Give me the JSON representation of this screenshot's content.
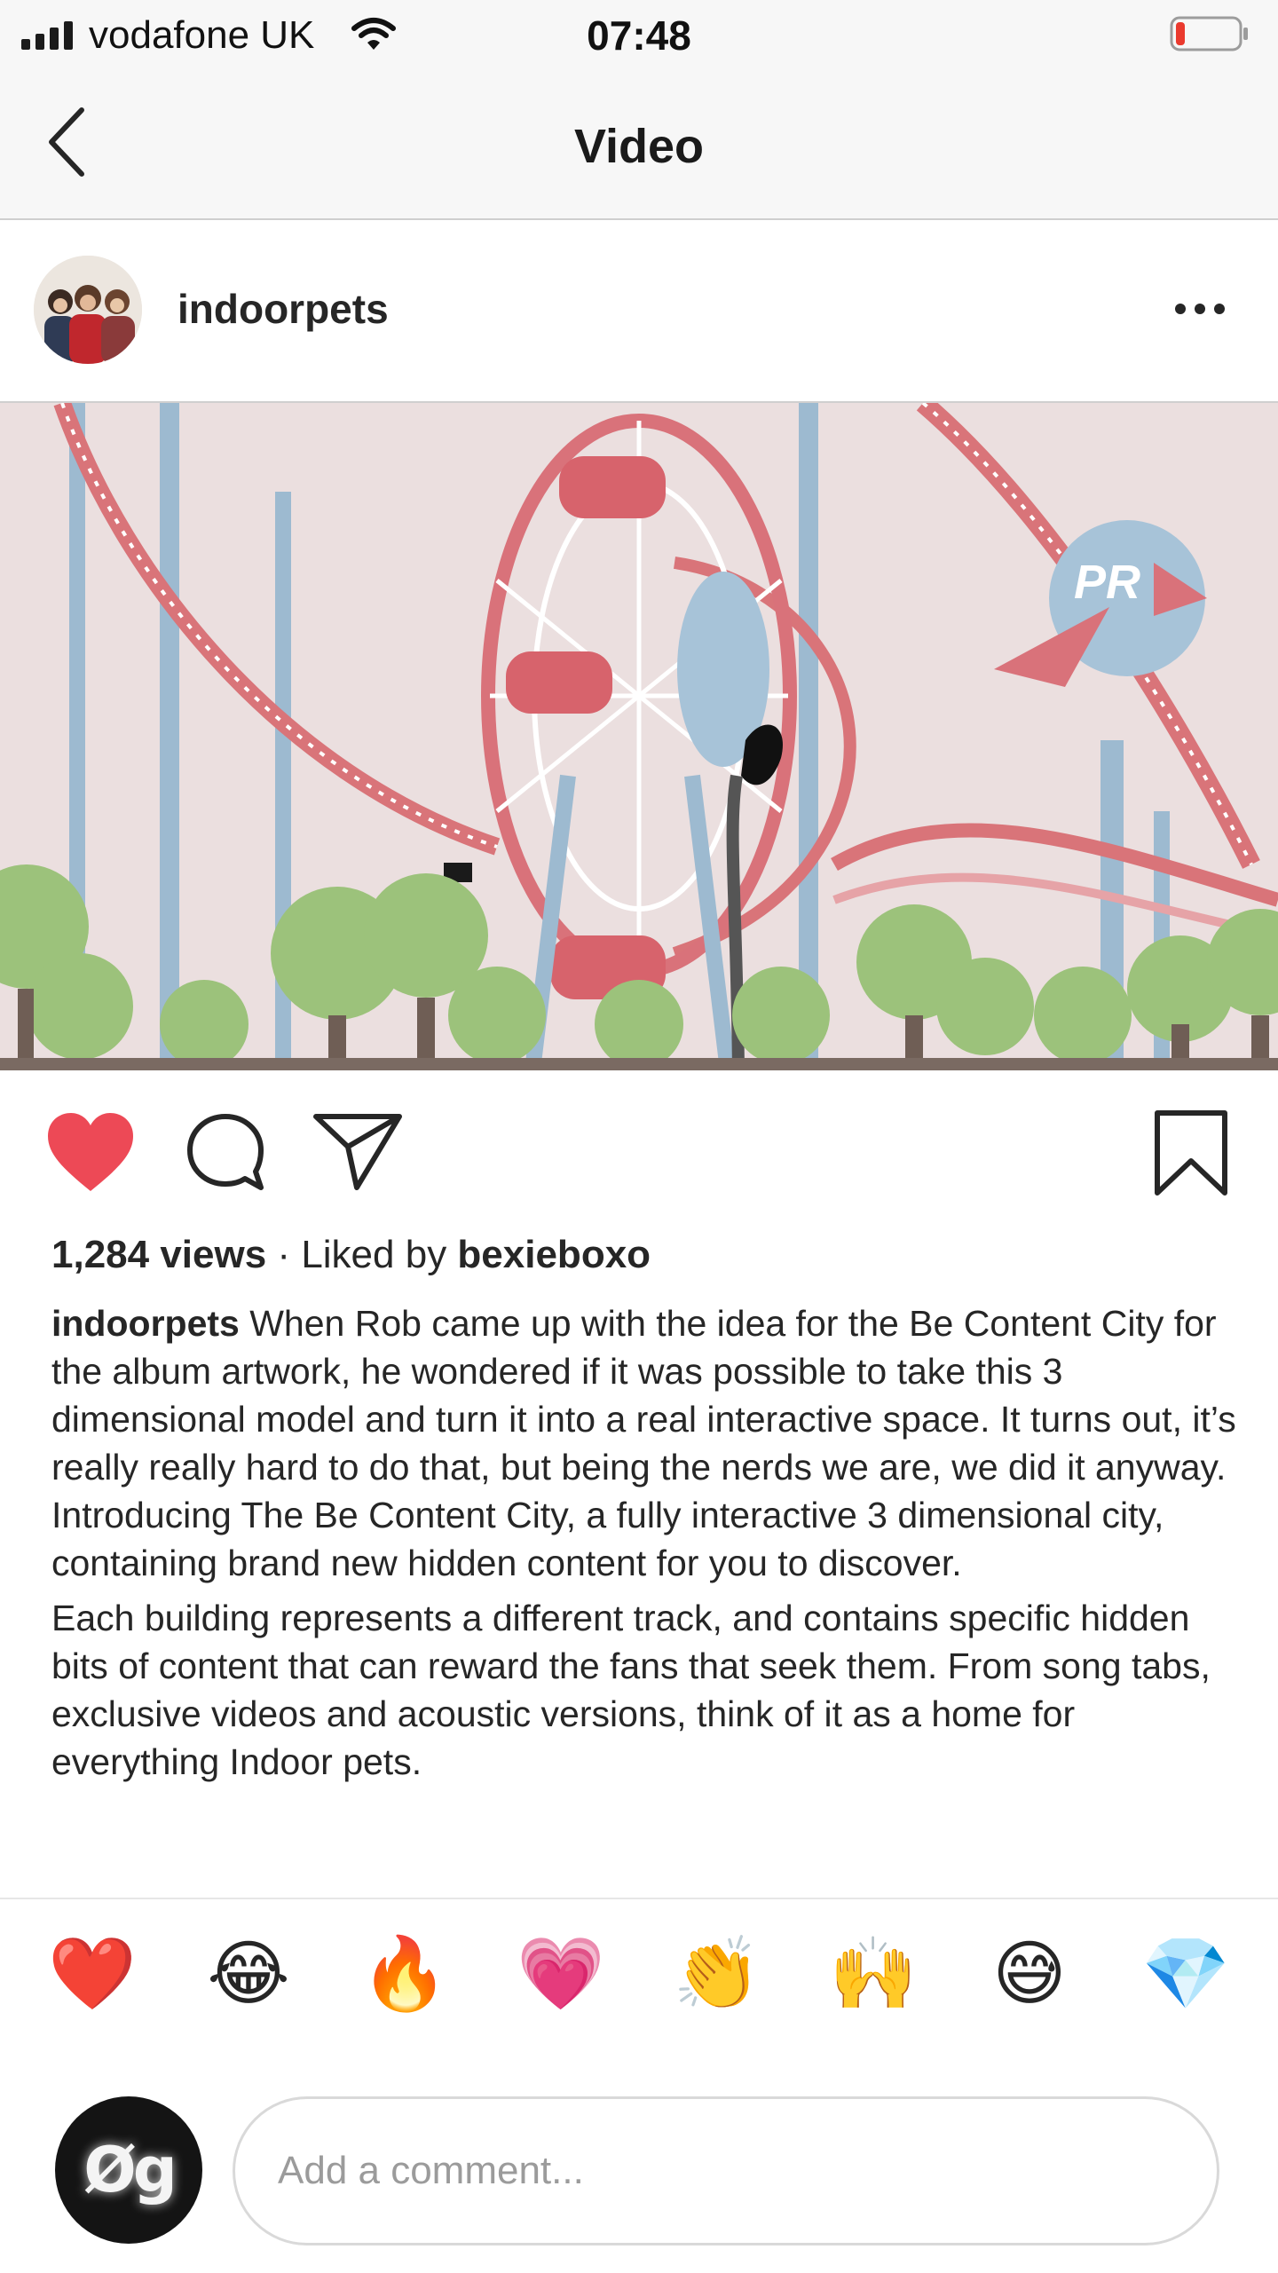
{
  "status_bar": {
    "carrier": "vodafone UK",
    "time": "07:48",
    "battery_level": 0.15,
    "battery_color": "#ea3a2e"
  },
  "nav": {
    "title": "Video",
    "back_icon": "chevron-left-icon"
  },
  "post": {
    "username": "indoorpets",
    "more_icon": "ellipsis-icon"
  },
  "actions": {
    "liked": true,
    "like_color": "#ed4956",
    "icons": [
      "heart-icon",
      "comment-icon",
      "share-icon",
      "bookmark-icon"
    ]
  },
  "stats": {
    "views": "1,284 views",
    "separator": " · ",
    "liked_by_prefix": "Liked by ",
    "liked_by_user": "bexieboxo"
  },
  "caption": {
    "username": "indoorpets",
    "paragraph1": " When Rob came up with the idea for the Be Content City for the album artwork, he wondered if it was possible to take this 3 dimensional model and turn it into a real interactive space. It turns out, it’s really really hard to do that, but being the nerds we are, we did it anyway. Introducing The Be Content City, a fully interactive 3 dimensional city, containing brand new hidden content for you to discover.",
    "paragraph2": "Each building represents a different track, and contains specific hidden bits of content that can reward the fans that seek them. From song tabs, exclusive videos and acoustic versions, think of it as a home for everything Indoor pets."
  },
  "reactions": [
    "❤️",
    "😂",
    "🔥",
    "💗",
    "👏",
    "🙌",
    "😅",
    "💎"
  ],
  "comment": {
    "placeholder": "Add a comment...",
    "avatar_text": "Øg"
  }
}
